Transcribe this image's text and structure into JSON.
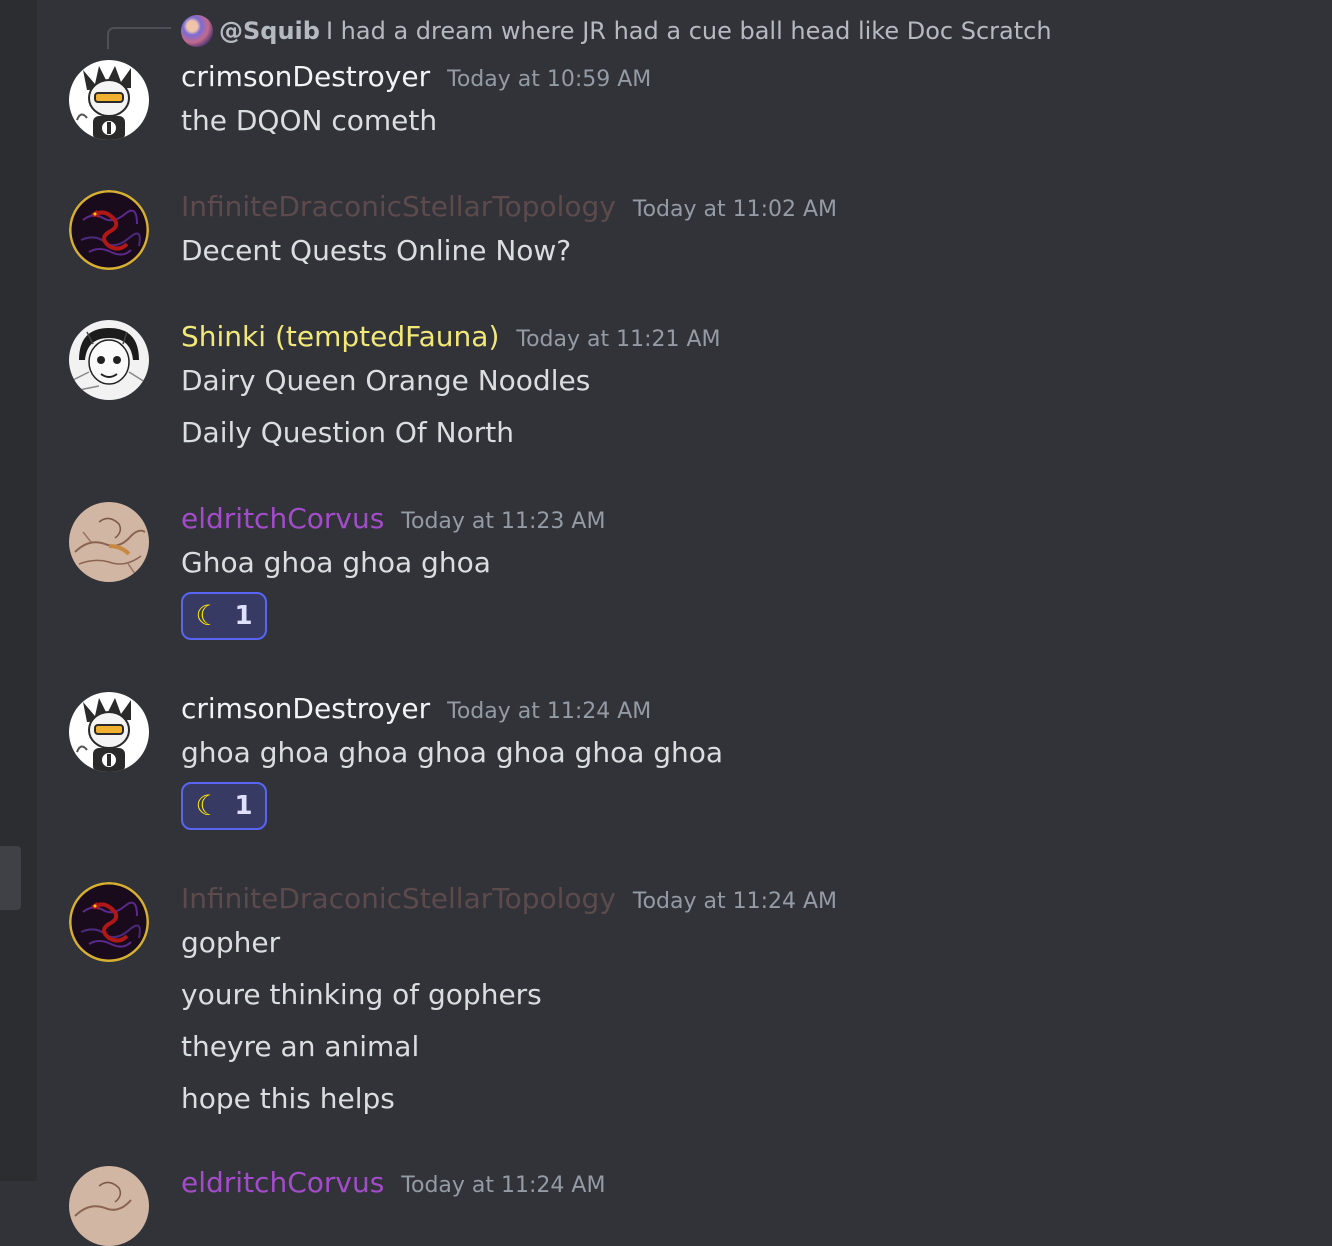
{
  "reply": {
    "username": "@Squib",
    "text": "I had a dream where JR had a cue ball head like Doc Scratch"
  },
  "messages": [
    {
      "username": "crimsonDestroyer",
      "name_color": "#f2f3f5",
      "avatar": "crimson-avatar",
      "timestamp": "Today at 10:59 AM",
      "lines": [
        "the DQON cometh"
      ]
    },
    {
      "username": "InfiniteDraconicStellarTopology",
      "name_color": "#5c4a4c",
      "avatar": "draconic-avatar",
      "timestamp": "Today at 11:02 AM",
      "lines": [
        "Decent Quests Online Now?"
      ]
    },
    {
      "username": "Shinki (temptedFauna)",
      "name_color": "#f1e879",
      "avatar": "shinki-avatar",
      "timestamp": "Today at 11:21 AM",
      "lines": [
        "Dairy Queen Orange Noodles",
        "Daily Question Of North"
      ]
    },
    {
      "username": "eldritchCorvus",
      "name_color": "#a34cc9",
      "avatar": "corvus-avatar",
      "timestamp": "Today at 11:23 AM",
      "lines": [
        "Ghoa ghoa ghoa ghoa"
      ],
      "reaction": {
        "emoji": "moon-emoji",
        "glyph": "☾",
        "count": "1"
      }
    },
    {
      "username": "crimsonDestroyer",
      "name_color": "#f2f3f5",
      "avatar": "crimson-avatar",
      "timestamp": "Today at 11:24 AM",
      "lines": [
        "ghoa ghoa ghoa ghoa ghoa ghoa ghoa"
      ],
      "reaction": {
        "emoji": "moon-emoji",
        "glyph": "☾",
        "count": "1"
      }
    },
    {
      "username": "InfiniteDraconicStellarTopology",
      "name_color": "#5c4a4c",
      "avatar": "draconic-avatar",
      "timestamp": "Today at 11:24 AM",
      "lines": [
        "gopher",
        "youre thinking of gophers",
        "theyre an animal",
        "hope this helps"
      ]
    }
  ],
  "partial_next": {
    "username": "eldritchCorvus",
    "timestamp": "Today at 11:24 AM"
  }
}
